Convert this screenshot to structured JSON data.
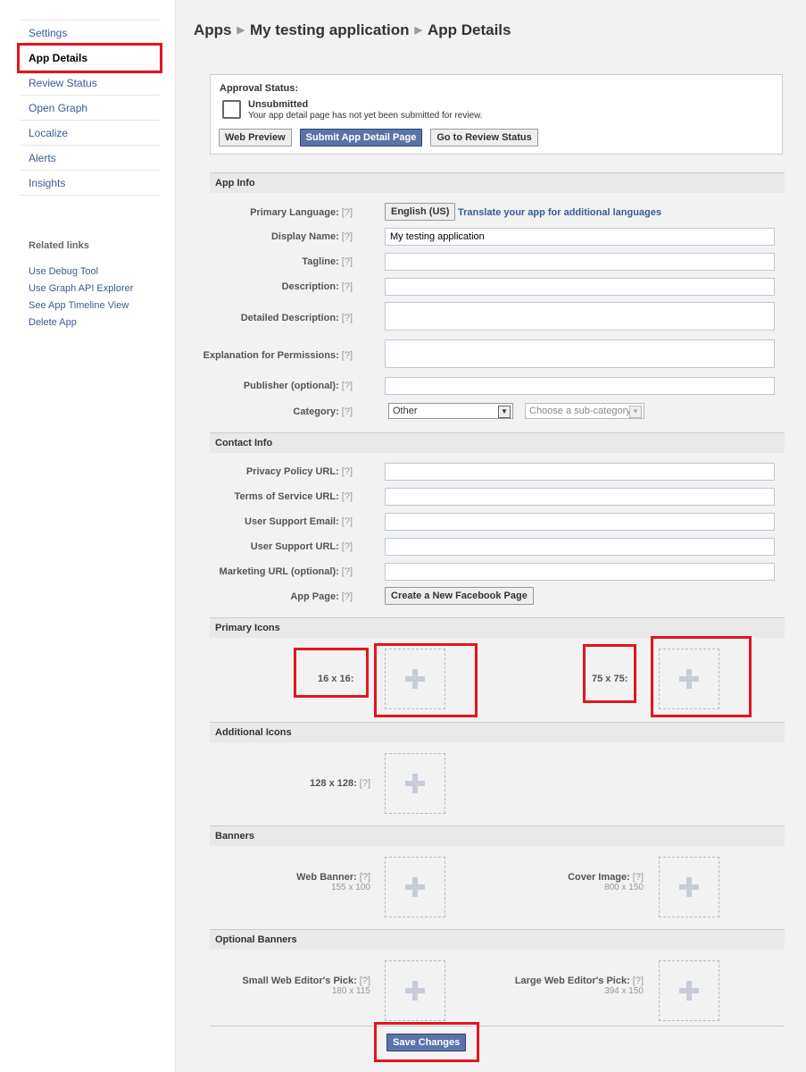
{
  "sidebar": {
    "items": [
      {
        "label": "Settings"
      },
      {
        "label": "App Details"
      },
      {
        "label": "Review Status"
      },
      {
        "label": "Open Graph"
      },
      {
        "label": "Localize"
      },
      {
        "label": "Alerts"
      },
      {
        "label": "Insights"
      }
    ],
    "related_title": "Related links",
    "related": [
      "Use Debug Tool",
      "Use Graph API Explorer",
      "See App Timeline View",
      "Delete App"
    ]
  },
  "breadcrumb": {
    "root": "Apps",
    "app": "My testing application",
    "page": "App Details",
    "sep": "▶"
  },
  "approval": {
    "title": "Approval Status:",
    "status": "Unsubmitted",
    "message": "Your app detail page has not yet been submitted for review.",
    "web_preview": "Web Preview",
    "submit": "Submit App Detail Page",
    "review": "Go to Review Status"
  },
  "help": "[?]",
  "app_info": {
    "title": "App Info",
    "primary_language_label": "Primary Language:",
    "language_button": "English (US)",
    "translate_link": "Translate your app for additional languages",
    "display_name_label": "Display Name:",
    "display_name_value": "My testing application",
    "tagline_label": "Tagline:",
    "description_label": "Description:",
    "detailed_description_label": "Detailed Description:",
    "permissions_label": "Explanation for Permissions:",
    "publisher_label": "Publisher (optional):",
    "category_label": "Category:",
    "category_value": "Other",
    "subcategory_value": "Choose a sub-category"
  },
  "contact_info": {
    "title": "Contact Info",
    "privacy_label": "Privacy Policy URL:",
    "tos_label": "Terms of Service URL:",
    "support_email_label": "User Support Email:",
    "support_url_label": "User Support URL:",
    "marketing_label": "Marketing URL (optional):",
    "app_page_label": "App Page:",
    "create_page_button": "Create a New Facebook Page"
  },
  "primary_icons": {
    "title": "Primary Icons",
    "small": "16 x 16:",
    "large": "75 x 75:"
  },
  "additional_icons": {
    "title": "Additional Icons",
    "big": "128 x 128:"
  },
  "banners": {
    "title": "Banners",
    "web_banner": "Web Banner:",
    "web_banner_dim": "155 x 100",
    "cover": "Cover Image:",
    "cover_dim": "800 x 150"
  },
  "optional_banners": {
    "title": "Optional Banners",
    "small_pick": "Small Web Editor's Pick:",
    "small_dim": "180 x 115",
    "large_pick": "Large Web Editor's Pick:",
    "large_dim": "394 x 150"
  },
  "save_label": "Save Changes",
  "colors": {
    "link": "#3b5998",
    "highlight": "#e5141e",
    "button_blue": "#5b74a8"
  }
}
